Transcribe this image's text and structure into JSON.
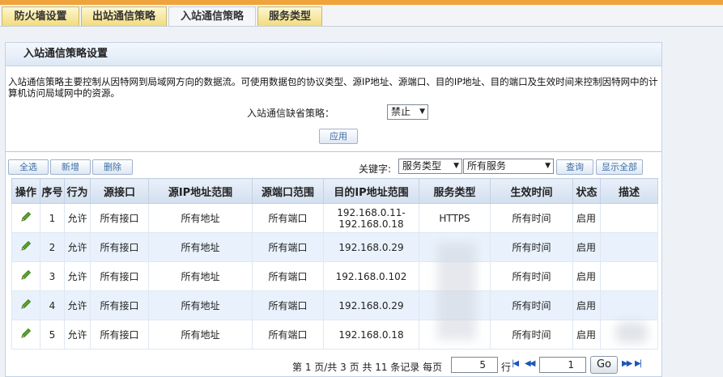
{
  "tabs": [
    {
      "label": "防火墙设置"
    },
    {
      "label": "出站通信策略"
    },
    {
      "label": "入站通信策略"
    },
    {
      "label": "服务类型"
    }
  ],
  "active_tab": 2,
  "panel": {
    "title": "入站通信策略设置",
    "description": "入站通信策略主要控制从因特网到局域网方向的数据流。可使用数据包的协议类型、源IP地址、源端口、目的IP地址、目的端口及生效时间来控制因特网中的计算机访问局域网中的资源。",
    "default_policy_label": "入站通信缺省策略：",
    "default_policy_value": "禁止",
    "apply_label": "应用"
  },
  "toolbar": {
    "select_all": "全选",
    "add": "新增",
    "delete": "删除",
    "keyword_label": "关键字:",
    "keyword_field": "服务类型",
    "keyword_value": "所有服务",
    "query": "查询",
    "show_all": "显示全部"
  },
  "table": {
    "headers": [
      "操作",
      "序号",
      "行为",
      "源接口",
      "源IP地址范围",
      "源端口范围",
      "目的IP地址范围",
      "服务类型",
      "生效时间",
      "状态",
      "描述"
    ],
    "rows": [
      {
        "no": "1",
        "action": "允许",
        "src_if": "所有接口",
        "src_ip": "所有地址",
        "src_port": "所有端口",
        "dst_ip_1": "192.168.0.11-",
        "dst_ip_2": "192.168.0.18",
        "service": "HTTPS",
        "time": "所有时间",
        "status": "启用",
        "desc": ""
      },
      {
        "no": "2",
        "action": "允许",
        "src_if": "所有接口",
        "src_ip": "所有地址",
        "src_port": "所有端口",
        "dst_ip_1": "192.168.0.29",
        "dst_ip_2": "",
        "service": "",
        "time": "所有时间",
        "status": "启用",
        "desc": ""
      },
      {
        "no": "3",
        "action": "允许",
        "src_if": "所有接口",
        "src_ip": "所有地址",
        "src_port": "所有端口",
        "dst_ip_1": "192.168.0.102",
        "dst_ip_2": "",
        "service": "",
        "time": "所有时间",
        "status": "启用",
        "desc": ""
      },
      {
        "no": "4",
        "action": "允许",
        "src_if": "所有接口",
        "src_ip": "所有地址",
        "src_port": "所有端口",
        "dst_ip_1": "192.168.0.29",
        "dst_ip_2": "",
        "service": "",
        "time": "所有时间",
        "status": "启用",
        "desc": ""
      },
      {
        "no": "5",
        "action": "允许",
        "src_if": "所有接口",
        "src_ip": "所有地址",
        "src_port": "所有端口",
        "dst_ip_1": "192.168.0.18",
        "dst_ip_2": "",
        "service": "",
        "time": "所有时间",
        "status": "启用",
        "desc": ""
      }
    ]
  },
  "pager": {
    "summary": "第 1 页/共 3 页 共 11 条记录 每页",
    "per_page": "5",
    "rows_unit": "行",
    "page_value": "1",
    "go_label": "Go"
  },
  "icons": {
    "edit": "pencil-icon",
    "first": "first-page-icon",
    "prev": "prev-page-icon",
    "next": "next-page-icon",
    "last": "last-page-icon"
  },
  "colors": {
    "accent_bar": "#f0a33a",
    "header_bg": "#d2dfef",
    "row_alt": "#e9f2fc",
    "link_blue": "#1c56b8"
  }
}
